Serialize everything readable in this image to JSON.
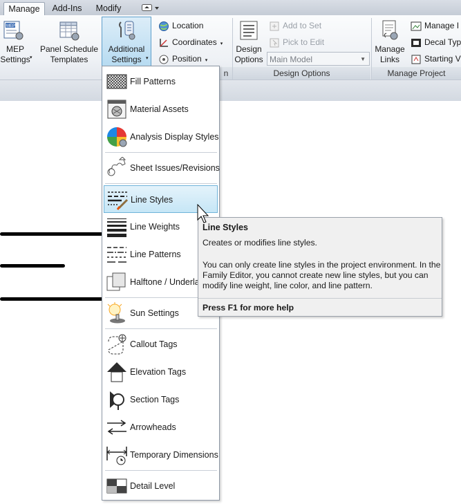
{
  "tabs": [
    {
      "label": "Manage",
      "active": true
    },
    {
      "label": "Add-Ins",
      "active": false
    },
    {
      "label": "Modify",
      "active": false
    }
  ],
  "ribbon": {
    "mep_settings": "MEP\nSettings",
    "panel_schedule": "Panel Schedule\nTemplates",
    "additional_settings": "Additional\nSettings",
    "location": "Location",
    "coordinates": "Coordinates",
    "position": "Position",
    "design_options": "Design\nOptions",
    "add_to_set": "Add to Set",
    "pick_to_edit": "Pick to Edit",
    "main_model": "Main Model",
    "design_options_panel": "Design Options",
    "manage_links": "Manage\nLinks",
    "manage_images": "Manage I",
    "decal_types": "Decal Typ",
    "starting_view": "Starting V",
    "manage_project_panel": "Manage Project",
    "hidden_panel_tail": "n"
  },
  "menu": {
    "items": [
      {
        "label": "Fill Patterns",
        "icon": "fill-patterns-icon"
      },
      {
        "label": "Material Assets",
        "icon": "material-assets-icon"
      },
      {
        "label": "Analysis Display Styles",
        "icon": "analysis-display-styles-icon"
      },
      {
        "label": "Sheet Issues/Revisions",
        "icon": "sheet-issues-icon"
      },
      {
        "label": "Line Styles",
        "icon": "line-styles-icon",
        "highlighted": true
      },
      {
        "label": "Line Weights",
        "icon": "line-weights-icon"
      },
      {
        "label": "Line Patterns",
        "icon": "line-patterns-icon"
      },
      {
        "label": "Halftone / Underlay",
        "icon": "halftone-icon"
      },
      {
        "label": "Sun Settings",
        "icon": "sun-settings-icon"
      },
      {
        "label": "Callout Tags",
        "icon": "callout-tags-icon"
      },
      {
        "label": "Elevation Tags",
        "icon": "elevation-tags-icon"
      },
      {
        "label": "Section Tags",
        "icon": "section-tags-icon"
      },
      {
        "label": "Arrowheads",
        "icon": "arrowheads-icon"
      },
      {
        "label": "Temporary Dimensions",
        "icon": "temporary-dimensions-icon"
      },
      {
        "label": "Detail Level",
        "icon": "detail-level-icon"
      }
    ]
  },
  "tooltip": {
    "title": "Line Styles",
    "summary": "Creates or modifies line styles.",
    "details": [
      "You can only create line styles in the project environment. In the",
      "Family Editor, you cannot create new line styles, but you can",
      "modify line weight, line color, and line pattern."
    ],
    "help": "Press F1 for more help"
  },
  "colors": {
    "highlight_bg": "#c6e6f6",
    "highlight_border": "#6fb3d9",
    "ribbon_bg": "#eef1f5"
  }
}
